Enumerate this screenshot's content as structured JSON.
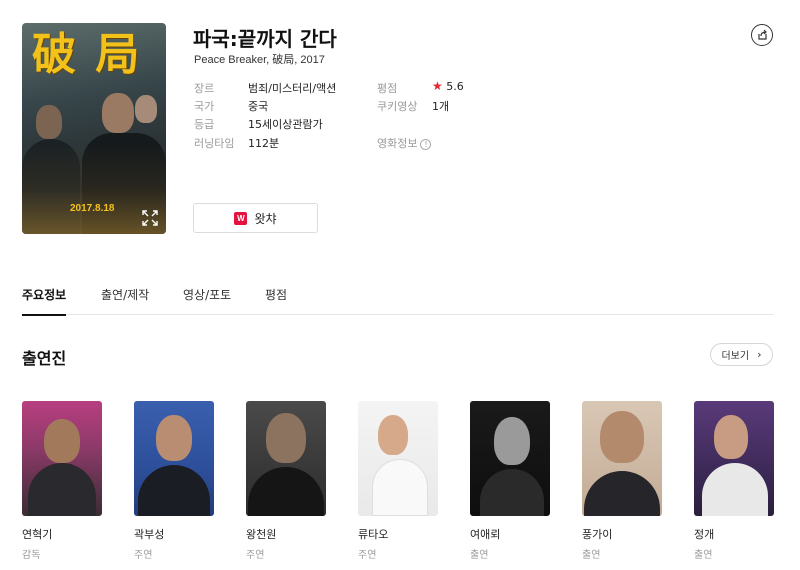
{
  "movie": {
    "title": "파국:끝까지 간다",
    "subtitle": "Peace Breaker, 破局, 2017",
    "poster_title": "破 局",
    "poster_date": "2017.8.18"
  },
  "info": {
    "genre_label": "장르",
    "genre_value": "범죄/미스터리/액션",
    "country_label": "국가",
    "country_value": "중국",
    "rating_label": "등급",
    "rating_value": "15세이상관람가",
    "runtime_label": "러닝타임",
    "runtime_value": "112분",
    "score_label": "평점",
    "score_star": "★",
    "score_value": "5.6",
    "cookie_label": "쿠키영상",
    "cookie_value": "1개",
    "movieinfo_label": "영화정보",
    "movieinfo_icon": "!"
  },
  "watcha": {
    "logo": "W",
    "label": "왓챠"
  },
  "tabs": [
    {
      "label": "주요정보",
      "active": true
    },
    {
      "label": "출연/제작",
      "active": false
    },
    {
      "label": "영상/포토",
      "active": false
    },
    {
      "label": "평점",
      "active": false
    }
  ],
  "cast_section": {
    "title": "출연진",
    "more_label": "더보기",
    "more_chevron": "›"
  },
  "cast": [
    {
      "name": "연혁기",
      "role": "감독"
    },
    {
      "name": "곽부성",
      "role": "주연"
    },
    {
      "name": "왕천원",
      "role": "주연"
    },
    {
      "name": "류타오",
      "role": "주연"
    },
    {
      "name": "여애뢰",
      "role": "출연"
    },
    {
      "name": "풍가이",
      "role": "출연"
    },
    {
      "name": "정개",
      "role": "출연"
    }
  ],
  "colors": {
    "accent_red": "#e8242e",
    "watcha_red": "#e5113f",
    "poster_gold": "#f2c21b"
  },
  "icons": [
    "share-icon",
    "expand-icon",
    "info-circle-icon",
    "chevron-right-icon",
    "star-icon"
  ]
}
